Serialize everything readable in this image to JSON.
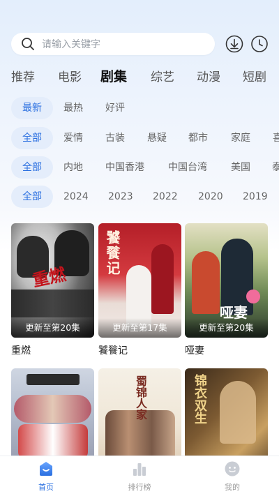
{
  "search": {
    "placeholder": "请输入关键字"
  },
  "icons": {
    "download": "download-icon",
    "history": "clock-icon",
    "search": "search-icon"
  },
  "category_tabs": [
    "推荐",
    "电影",
    "剧集",
    "综艺",
    "动漫",
    "短剧"
  ],
  "category_active": "剧集",
  "filters": {
    "sort": [
      "最新",
      "最热",
      "好评"
    ],
    "genre": [
      "全部",
      "爱情",
      "古装",
      "悬疑",
      "都市",
      "家庭",
      "喜"
    ],
    "region": [
      "全部",
      "内地",
      "中国香港",
      "中国台湾",
      "美国",
      "泰"
    ],
    "year": [
      "全部",
      "2024",
      "2023",
      "2022",
      "2020",
      "2019"
    ]
  },
  "cards": [
    {
      "title": "重燃",
      "update": "更新至第20集",
      "art": "重燃"
    },
    {
      "title": "饕餮记",
      "update": "更新至第17集",
      "art": "饕餮记"
    },
    {
      "title": "哑妻",
      "update": "更新至第20集",
      "art": "哑妻"
    },
    {
      "title": "",
      "update": "",
      "art": ""
    },
    {
      "title": "",
      "update": "",
      "art": "蜀锦人家"
    },
    {
      "title": "",
      "update": "",
      "art": "锦衣双生"
    }
  ],
  "bottom_nav": [
    {
      "label": "首页",
      "icon": "home-icon",
      "active": true
    },
    {
      "label": "排行榜",
      "icon": "bar-chart-icon",
      "active": false
    },
    {
      "label": "我的",
      "icon": "profile-icon",
      "active": false
    }
  ],
  "colors": {
    "accent": "#2a6fe0",
    "chip_active_bg": "#e4edfb"
  }
}
